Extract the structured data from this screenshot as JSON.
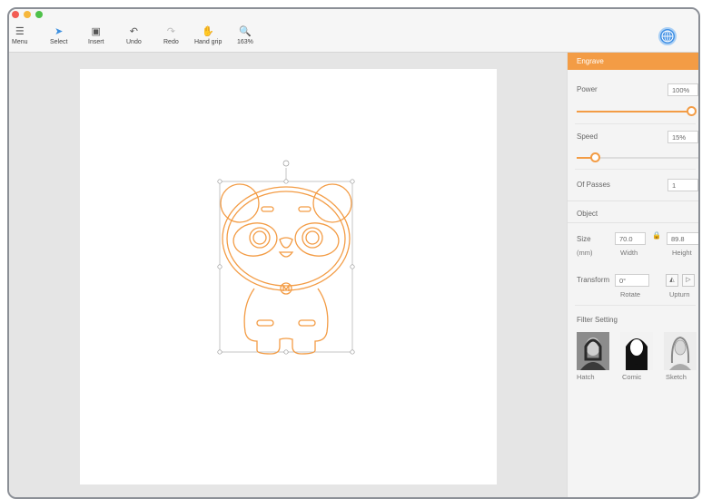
{
  "toolbar": {
    "menu": "Menu",
    "select": "Select",
    "insert": "Insert",
    "undo": "Undo",
    "redo": "Redo",
    "hand_grip": "Hand grip",
    "zoom": "163%"
  },
  "panel": {
    "engrave_title": "Engrave",
    "power_label": "Power",
    "power_value": "100%",
    "power_level": 1.0,
    "speed_label": "Speed",
    "speed_value": "15%",
    "speed_level": 0.15,
    "passes_label": "Of Passes",
    "passes_value": "1",
    "object_title": "Object",
    "size_label": "Size",
    "size_unit": "(mm)",
    "width_value": "70.0",
    "height_value": "89.8",
    "width_label": "Width",
    "height_label": "Height",
    "transform_label": "Transform",
    "rotate_value": "0°",
    "rotate_label": "Rotate",
    "upturn_label": "Upturn",
    "filter_title": "Filter Setting",
    "filters": [
      "Hatch",
      "Comic",
      "Sketch"
    ]
  },
  "colors": {
    "accent": "#f39c45",
    "selected_tool": "#3b8fe0"
  },
  "icons": [
    "menu-icon",
    "select-arrow-icon",
    "insert-icon",
    "undo-icon",
    "redo-icon",
    "hand-icon",
    "zoom-icon",
    "globe-icon",
    "lock-icon",
    "flip-horizontal-icon",
    "flip-vertical-icon",
    "rotate-handle-icon"
  ]
}
